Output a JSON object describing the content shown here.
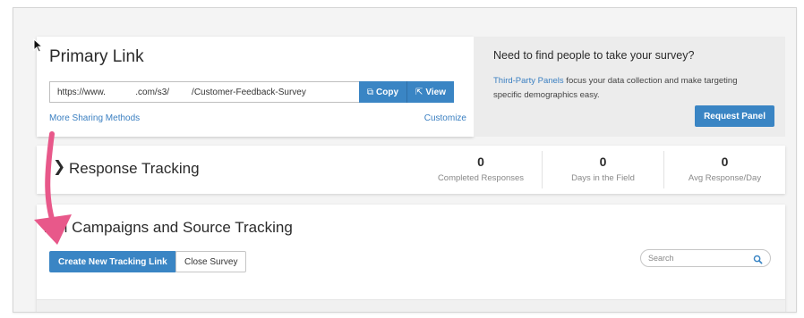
{
  "primary_link": {
    "title": "Primary Link",
    "url_value": "https://www.            .com/s3/         /Customer-Feedback-Survey",
    "copy_label": "Copy",
    "view_label": "View",
    "more_sharing_label": "More Sharing Methods",
    "customize_label": "Customize"
  },
  "promo": {
    "title": "Need to find people to take your survey?",
    "link_text": "Third-Party Panels",
    "body_text": " focus your data collection and make targeting specific demographics easy.",
    "button_label": "Request Panel"
  },
  "response_tracking": {
    "title": "Response Tracking",
    "stats": [
      {
        "value": "0",
        "label": "Completed Responses"
      },
      {
        "value": "0",
        "label": "Days in the Field"
      },
      {
        "value": "0",
        "label": "Avg Response/Day"
      }
    ]
  },
  "campaigns": {
    "title": "nail Campaigns and Source Tracking",
    "create_label": "Create New Tracking Link",
    "close_label": "Close Survey",
    "search_placeholder": "Search"
  },
  "colors": {
    "accent": "#3a85c4",
    "link": "#3a7fc1",
    "annotation_arrow": "#e8588a"
  },
  "icons": {
    "copy": "copy-icon",
    "view": "external-link-icon",
    "search": "search-icon",
    "chevron": "chevron-right-icon"
  }
}
